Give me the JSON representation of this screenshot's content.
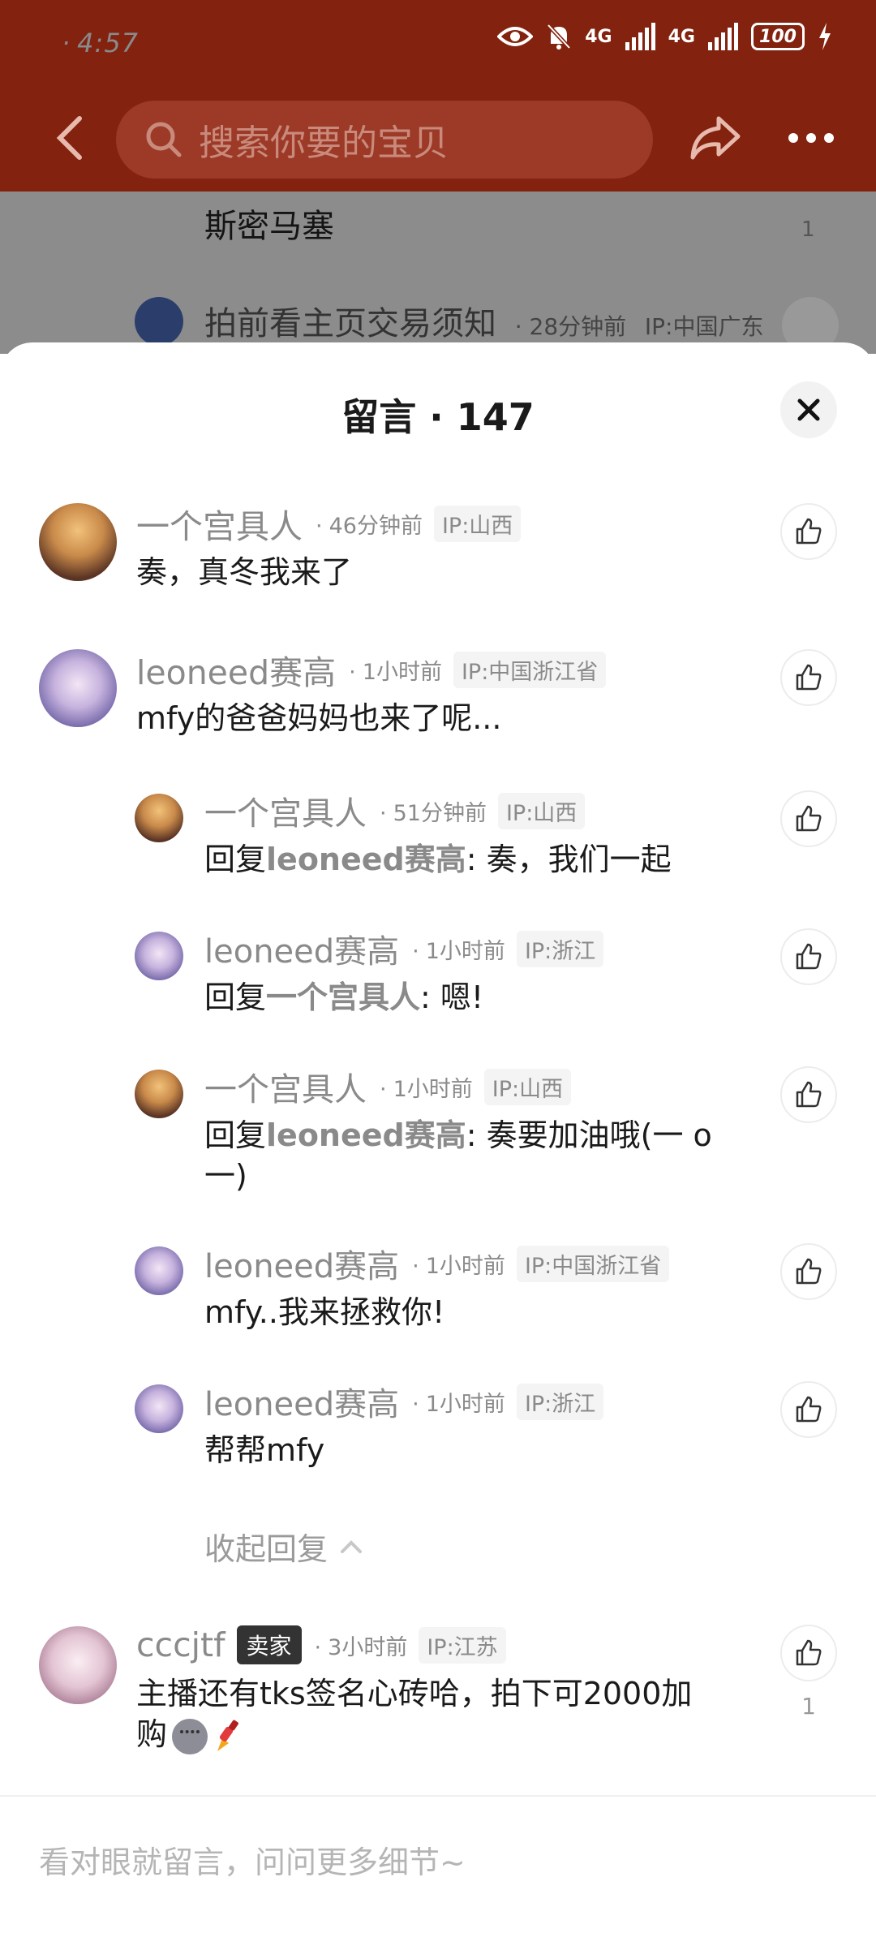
{
  "status_bar": {
    "time": "4:57",
    "network_1": "4G",
    "network_2": "4G",
    "battery": "100",
    "icons": [
      "eye-icon",
      "bell-muted-icon",
      "signal-icon",
      "signal-icon",
      "battery-icon",
      "charging-icon"
    ]
  },
  "header": {
    "search_placeholder": "搜索你要的宝贝",
    "icons": [
      "back-icon",
      "search-icon",
      "share-icon",
      "more-icon"
    ]
  },
  "background_page": {
    "row1_text": "斯密马塞",
    "row1_like_count": "1",
    "row2_user": "拍前看主页交易须知",
    "row2_time": "· 28分钟前",
    "row2_ip": "IP:中国广东"
  },
  "sheet": {
    "title": "留言 · 147",
    "comments": [
      {
        "user": "一个宫具人",
        "time": "46分钟前",
        "ip": "IP:山西",
        "text": "奏，真冬我来了"
      },
      {
        "user": "leoneed赛高",
        "time": "1小时前",
        "ip": "IP:中国浙江省",
        "text": "mfy的爸爸妈妈也来了呢..."
      }
    ],
    "replies": [
      {
        "user": "一个宫具人",
        "time": "51分钟前",
        "ip": "IP:山西",
        "prefix": "回复",
        "reply_to": "leoneed赛高",
        "text": ": 奏，我们一起"
      },
      {
        "user": "leoneed赛高",
        "time": "1小时前",
        "ip": "IP:浙江",
        "prefix": "回复",
        "reply_to": "一个宫具人",
        "text": ": 嗯!"
      },
      {
        "user": "一个宫具人",
        "time": "1小时前",
        "ip": "IP:山西",
        "prefix": "回复",
        "reply_to": "leoneed赛高",
        "text": ":    奏要加油哦(一 o 一)"
      },
      {
        "user": "leoneed赛高",
        "time": "1小时前",
        "ip": "IP:中国浙江省",
        "text": "mfy..我来拯救你!"
      },
      {
        "user": "leoneed赛高",
        "time": "1小时前",
        "ip": "IP:浙江",
        "text": "帮帮mfy"
      }
    ],
    "collapse_label": "收起回复",
    "seller_comment": {
      "user": "cccjtf",
      "badge": "卖家",
      "time": "3小时前",
      "ip": "IP:江苏",
      "text": "主播还有tks签名心砖哈，拍下可2000加购",
      "like_count": "1"
    },
    "input_placeholder": "看对眼就留言，问问更多细节~"
  },
  "colors": {
    "header_bg": "#82220f",
    "search_bg": "#9c3a27",
    "muted_text": "#8a8a8a",
    "seller_badge_bg": "#333333"
  }
}
